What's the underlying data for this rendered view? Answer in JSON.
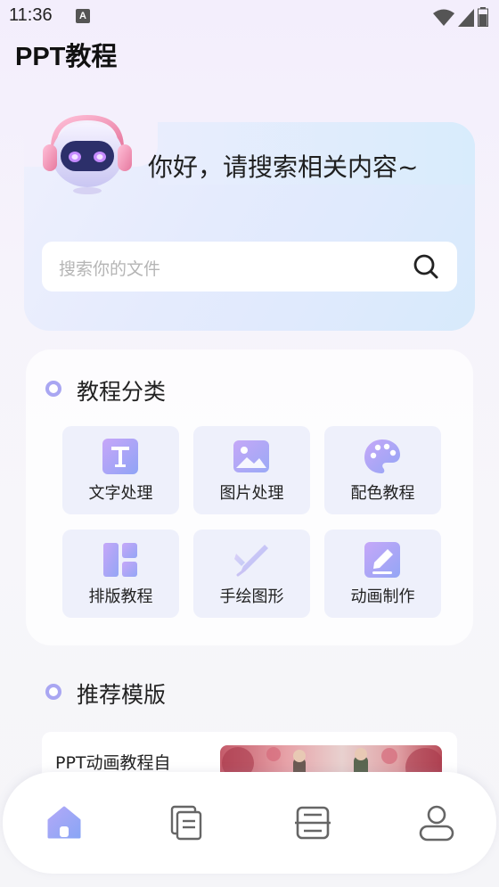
{
  "status": {
    "time": "11:36",
    "notification_badge": "A"
  },
  "app": {
    "title": "PPT教程"
  },
  "hero": {
    "greeting": "你好，请搜索相关内容~",
    "search_placeholder": "搜索你的文件"
  },
  "categories": {
    "title": "教程分类",
    "items": [
      {
        "label": "文字处理",
        "icon": "text-t-icon"
      },
      {
        "label": "图片处理",
        "icon": "image-icon"
      },
      {
        "label": "配色教程",
        "icon": "palette-icon"
      },
      {
        "label": "排版教程",
        "icon": "layout-icon"
      },
      {
        "label": "手绘图形",
        "icon": "pen-draw-icon"
      },
      {
        "label": "动画制作",
        "icon": "edit-pencil-icon"
      }
    ]
  },
  "recommend": {
    "title": "推荐模版",
    "items": [
      {
        "title": "PPT动画教程自"
      }
    ]
  },
  "nav": {
    "items": [
      {
        "icon": "home-icon",
        "active": true
      },
      {
        "icon": "document-icon",
        "active": false
      },
      {
        "icon": "scan-icon",
        "active": false
      },
      {
        "icon": "user-icon",
        "active": false
      }
    ]
  },
  "colors": {
    "accent": "#8f8cf4",
    "accent_light": "#a9a6f2",
    "tile_bg": "#eef0fb"
  }
}
